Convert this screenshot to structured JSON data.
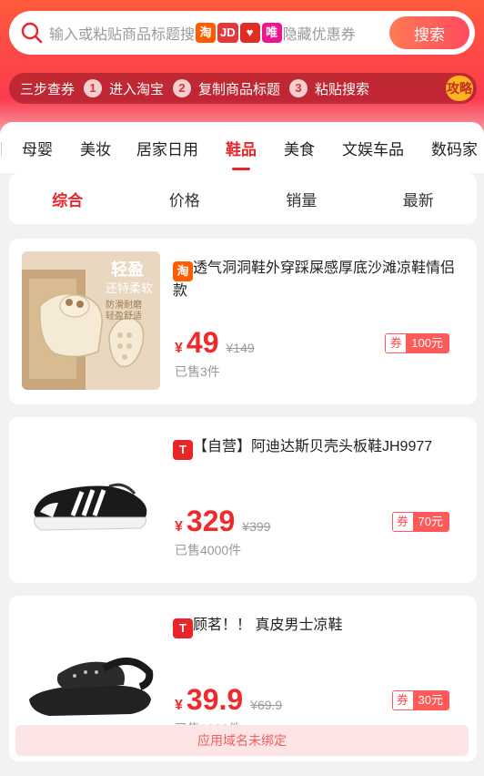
{
  "search": {
    "placeholder_prefix": "输入或粘贴商品标题搜",
    "platforms": [
      "淘",
      "JD",
      "♥",
      "唯"
    ],
    "placeholder_suffix": "隐藏优惠券",
    "button": "搜索"
  },
  "steps": {
    "label": "三步查券",
    "items": [
      {
        "num": "1",
        "text": "进入淘宝"
      },
      {
        "num": "2",
        "text": "复制商品标题"
      },
      {
        "num": "3",
        "text": "粘贴搜索"
      }
    ],
    "guide_button": "攻略"
  },
  "categories": [
    {
      "label": "母婴",
      "active": false
    },
    {
      "label": "美妆",
      "active": false
    },
    {
      "label": "居家日用",
      "active": false
    },
    {
      "label": "鞋品",
      "active": true
    },
    {
      "label": "美食",
      "active": false
    },
    {
      "label": "文娱车品",
      "active": false
    },
    {
      "label": "数码家",
      "active": false
    }
  ],
  "sort": [
    {
      "label": "综合",
      "active": true
    },
    {
      "label": "价格",
      "active": false
    },
    {
      "label": "销量",
      "active": false
    },
    {
      "label": "最新",
      "active": false
    }
  ],
  "products": [
    {
      "platform": "淘",
      "title": "透气洞洞鞋外穿踩屎感厚底沙滩凉鞋情侣款",
      "yen": "¥",
      "price": "49",
      "original_price": "¥149",
      "sold": "已售3件",
      "coupon_label": "券",
      "coupon_value": "100元",
      "image_text": [
        "轻盈",
        "还特柔软",
        "防滑耐磨",
        "轻盈舒适"
      ]
    },
    {
      "platform": "T",
      "title": "【自营】阿迪达斯贝壳头板鞋JH9977",
      "yen": "¥",
      "price": "329",
      "original_price": "¥399",
      "sold": "已售4000件",
      "coupon_label": "券",
      "coupon_value": "70元"
    },
    {
      "platform": "T",
      "title": "顾茗！！ 真皮男士凉鞋",
      "yen": "¥",
      "price": "39.9",
      "original_price": "¥69.9",
      "sold": "已售1000件",
      "coupon_label": "券",
      "coupon_value": "30元"
    }
  ],
  "toast": "应用域名未绑定",
  "colors": {
    "brand_red": "#e8262a",
    "price_red": "#f02a2a",
    "taobao_orange": "#ff5b00",
    "guide_yellow": "#ffb320"
  }
}
